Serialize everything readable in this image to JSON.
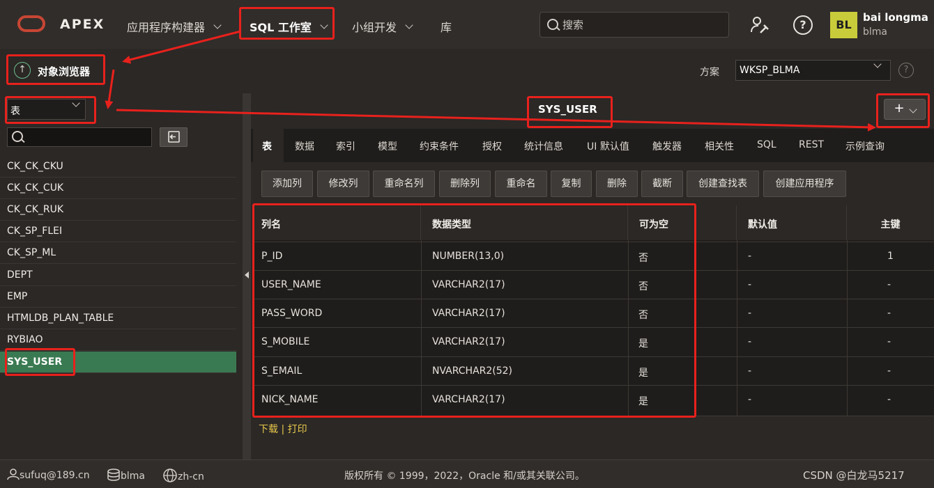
{
  "header": {
    "logo": "APEX",
    "nav": [
      {
        "label": "应用程序构建器",
        "has_menu": true
      },
      {
        "label": "SQL 工作室",
        "has_menu": true,
        "active": true
      },
      {
        "label": "小组开发",
        "has_menu": true
      },
      {
        "label": "库",
        "has_menu": false
      }
    ],
    "search_placeholder": "搜索",
    "user_initials": "BL",
    "user_name": "bai longma",
    "user_id": "blma",
    "help": "?"
  },
  "subheader": {
    "title": "对象浏览器",
    "schema_label": "方案",
    "schema_value": "WKSP_BLMA",
    "help": "?"
  },
  "left": {
    "object_type": "表",
    "objects": [
      "CK_CK_CKU",
      "CK_CK_CUK",
      "CK_CK_RUK",
      "CK_SP_FLEI",
      "CK_SP_ML",
      "DEPT",
      "EMP",
      "HTMLDB_PLAN_TABLE",
      "RYBIAO",
      "SYS_USER"
    ],
    "selected": "SYS_USER"
  },
  "main": {
    "table_name": "SYS_USER",
    "add_label": "+",
    "tabs": [
      "表",
      "数据",
      "索引",
      "模型",
      "约束条件",
      "授权",
      "统计信息",
      "UI 默认值",
      "触发器",
      "相关性",
      "SQL",
      "REST",
      "示例查询"
    ],
    "actions": [
      "添加列",
      "修改列",
      "重命名列",
      "删除列",
      "重命名",
      "复制",
      "删除",
      "截断",
      "创建查找表",
      "创建应用程序"
    ],
    "columns": [
      "列名",
      "数据类型",
      "可为空",
      "默认值",
      "主键"
    ],
    "rows": [
      [
        "P_ID",
        "NUMBER(13,0)",
        "否",
        "-",
        "1"
      ],
      [
        "USER_NAME",
        "VARCHAR2(17)",
        "否",
        "-",
        "-"
      ],
      [
        "PASS_WORD",
        "VARCHAR2(17)",
        "否",
        "-",
        "-"
      ],
      [
        "S_MOBILE",
        "VARCHAR2(17)",
        "是",
        "-",
        "-"
      ],
      [
        "S_EMAIL",
        "NVARCHAR2(52)",
        "是",
        "-",
        "-"
      ],
      [
        "NICK_NAME",
        "VARCHAR2(17)",
        "是",
        "-",
        "-"
      ]
    ],
    "download": "下载",
    "sep": "|",
    "print": "打印"
  },
  "footer": {
    "email": "sufuq@189.cn",
    "workspace": "blma",
    "lang": "zh-cn",
    "copyright": "版权所有 © 1999，2022，Oracle 和/或其关联公司。",
    "watermark": "CSDN @白龙马5217"
  },
  "colors": {
    "accent": "#3a7a52",
    "annotation": "#e8211c",
    "brand": "#c74634"
  }
}
